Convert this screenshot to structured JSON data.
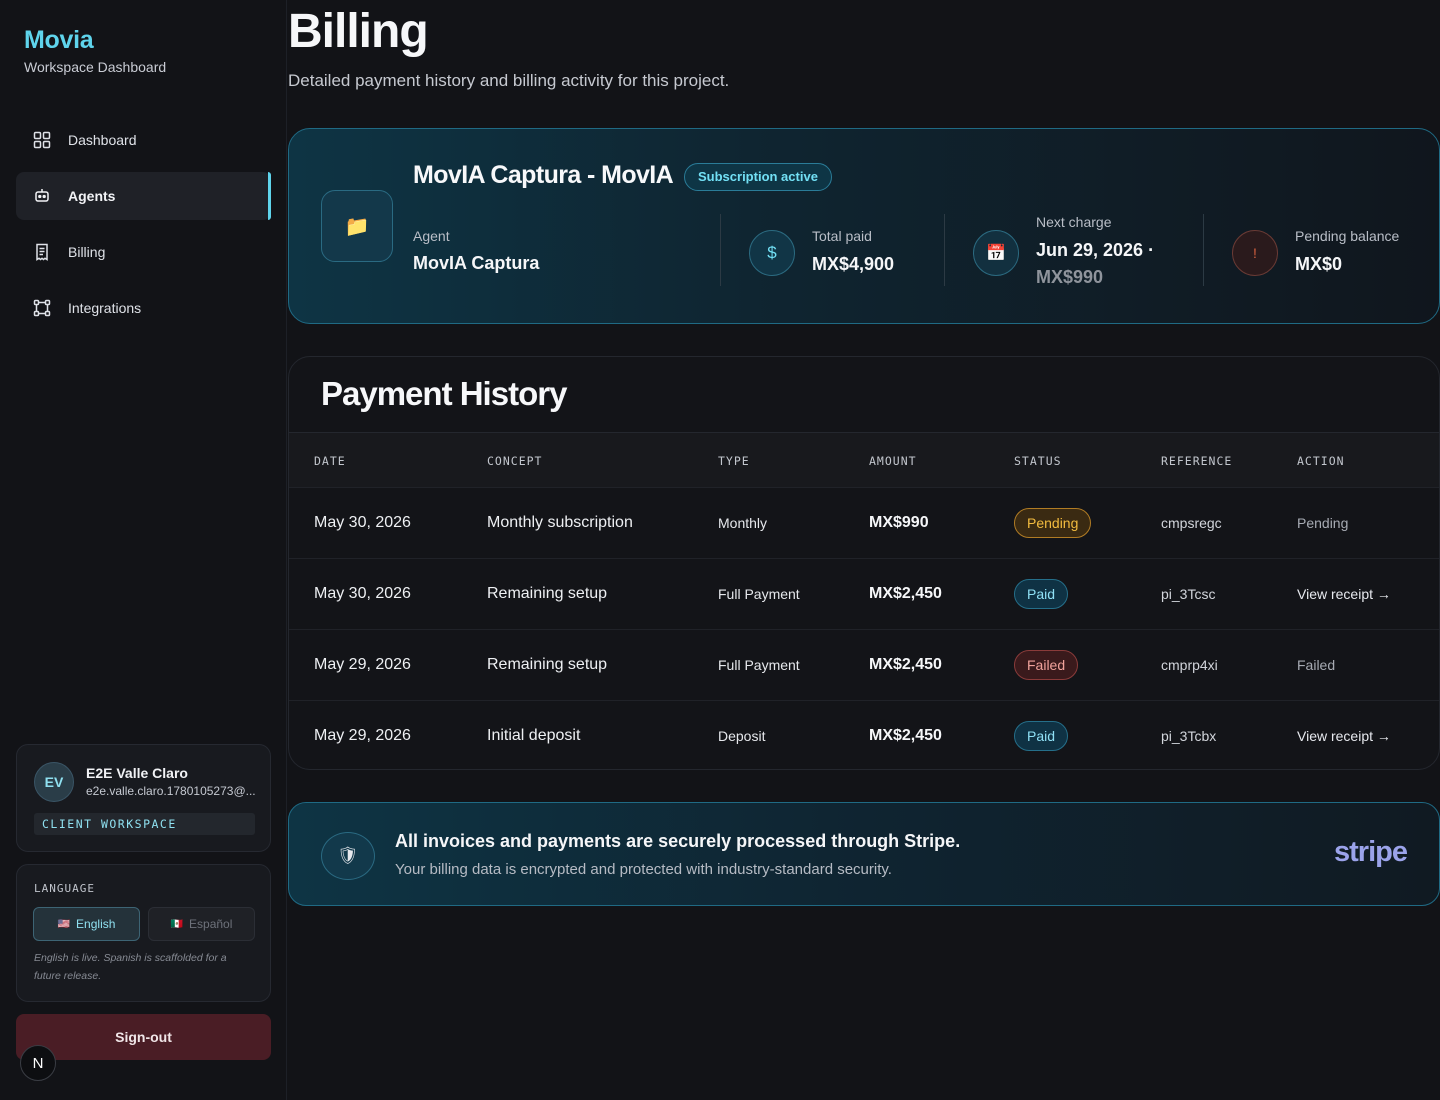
{
  "brand": {
    "name": "Movia",
    "subtitle": "Workspace Dashboard"
  },
  "sidebar": {
    "items": [
      {
        "label": "Dashboard",
        "icon": "grid-icon",
        "active": false
      },
      {
        "label": "Agents",
        "icon": "bot-icon",
        "active": true
      },
      {
        "label": "Billing",
        "icon": "receipt-icon",
        "active": false
      },
      {
        "label": "Integrations",
        "icon": "nodes-icon",
        "active": false
      }
    ]
  },
  "user": {
    "initials": "EV",
    "name": "E2E Valle Claro",
    "email": "e2e.valle.claro.1780105273@...",
    "workspace": "CLIENT WORKSPACE"
  },
  "language": {
    "label": "LANGUAGE",
    "options": [
      {
        "flag": "🇺🇸",
        "label": "English",
        "selected": true
      },
      {
        "flag": "🇲🇽",
        "label": "Español",
        "selected": false
      }
    ],
    "note": "English is live. Spanish is scaffolded for a future release."
  },
  "signout_label": "Sign-out",
  "n_badge": "N",
  "page": {
    "title": "Billing",
    "subtitle": "Detailed payment history and billing activity for this project."
  },
  "summary": {
    "agent_title": "MovIA Captura - MovIA",
    "badge": "Subscription active",
    "agent_label": "Agent",
    "agent_value": "MovIA Captura",
    "total_paid_label": "Total paid",
    "total_paid_value": "MX$4,900",
    "next_charge_label": "Next charge",
    "next_charge_date": "Jun 29, 2026 ·",
    "next_charge_amount": "MX$990",
    "pending_label": "Pending balance",
    "pending_value": "MX$0",
    "icons": {
      "folder": "📁",
      "dollar": "$",
      "calendar": "📅",
      "warning": "!"
    }
  },
  "history": {
    "title": "Payment History",
    "columns": [
      "DATE",
      "CONCEPT",
      "TYPE",
      "AMOUNT",
      "STATUS",
      "REFERENCE",
      "ACTION"
    ],
    "rows": [
      {
        "date": "May 30, 2026",
        "concept": "Monthly subscription",
        "type": "Monthly",
        "amount": "MX$990",
        "status": "Pending",
        "reference": "cmpsregc",
        "action": "Pending"
      },
      {
        "date": "May 30, 2026",
        "concept": "Remaining setup",
        "type": "Full Payment",
        "amount": "MX$2,450",
        "status": "Paid",
        "reference": "pi_3Tcsc",
        "action": "View receipt →"
      },
      {
        "date": "May 29, 2026",
        "concept": "Remaining setup",
        "type": "Full Payment",
        "amount": "MX$2,450",
        "status": "Failed",
        "reference": "cmprp4xi",
        "action": "Failed"
      },
      {
        "date": "May 29, 2026",
        "concept": "Initial deposit",
        "type": "Deposit",
        "amount": "MX$2,450",
        "status": "Paid",
        "reference": "pi_3Tcbx",
        "action": "View receipt →"
      }
    ]
  },
  "stripe": {
    "title": "All invoices and payments are securely processed through Stripe.",
    "subtitle": "Your billing data is encrypted and protected with industry-standard security.",
    "logo": "stripe",
    "icon": "🛡"
  },
  "colors": {
    "accent": "#5fd4ec",
    "pending": "#f2bb3f",
    "paid": "#8fe0f5",
    "failed": "#f0a29b",
    "signout": "#4a1d25"
  }
}
